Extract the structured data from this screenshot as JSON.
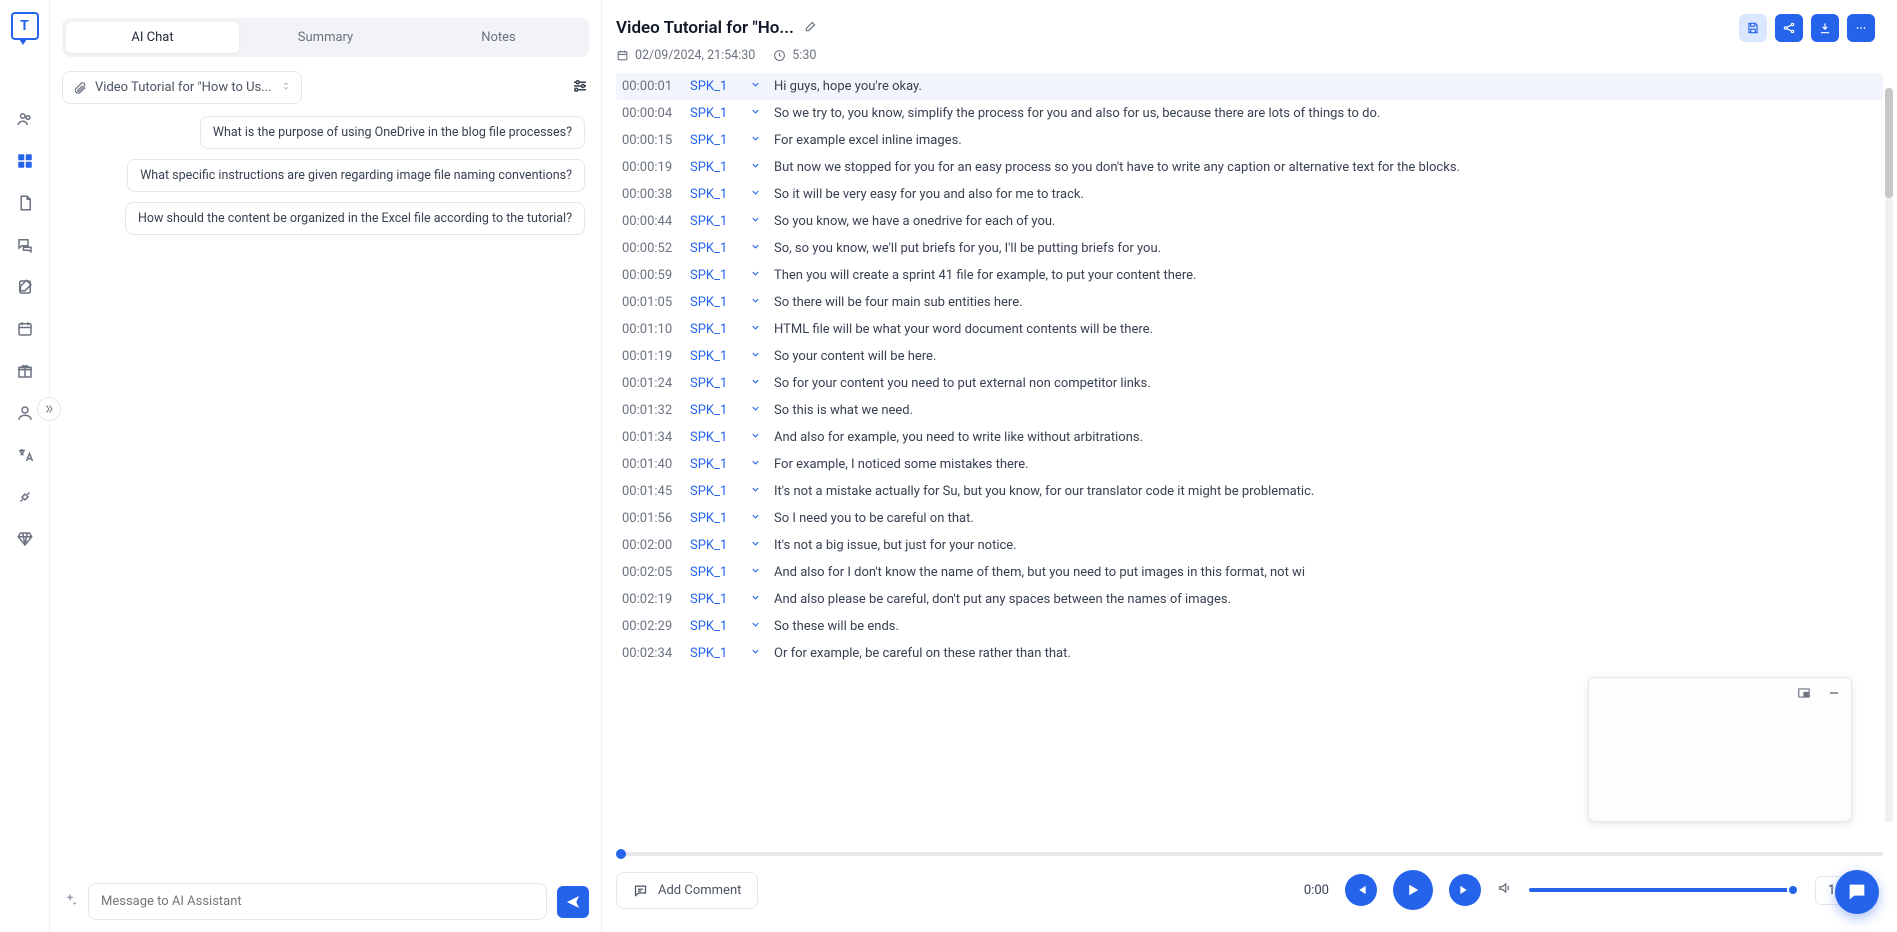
{
  "tabs": {
    "ai_chat": "AI Chat",
    "summary": "Summary",
    "notes": "Notes"
  },
  "file_chip": "Video Tutorial for \"How to Us...",
  "suggestions": [
    "What is the purpose of using OneDrive in the blog file processes?",
    "What specific instructions are given regarding image file naming conventions?",
    "How should the content be organized in the Excel file according to the tutorial?"
  ],
  "msg_placeholder": "Message to AI Assistant",
  "title": "Video Tutorial for \"Ho...",
  "meta": {
    "date": "02/09/2024, 21:54:30",
    "duration": "5:30"
  },
  "transcript": [
    {
      "t": "00:00:01",
      "s": "SPK_1",
      "x": "Hi guys, hope you're okay.",
      "hl": true
    },
    {
      "t": "00:00:04",
      "s": "SPK_1",
      "x": "So we try to, you know, simplify the process for you and also for us, because there are lots of things to do."
    },
    {
      "t": "00:00:15",
      "s": "SPK_1",
      "x": "For example excel inline images."
    },
    {
      "t": "00:00:19",
      "s": "SPK_1",
      "x": "But now we stopped for you for an easy process so you don't have to write any caption or alternative text for the blocks."
    },
    {
      "t": "00:00:38",
      "s": "SPK_1",
      "x": "So it will be very easy for you and also for me to track."
    },
    {
      "t": "00:00:44",
      "s": "SPK_1",
      "x": "So you know, we have a onedrive for each of you."
    },
    {
      "t": "00:00:52",
      "s": "SPK_1",
      "x": "So, so you know, we'll put briefs for you, I'll be putting briefs for you."
    },
    {
      "t": "00:00:59",
      "s": "SPK_1",
      "x": "Then you will create a sprint 41 file for example, to put your content there."
    },
    {
      "t": "00:01:05",
      "s": "SPK_1",
      "x": "So there will be four main sub entities here."
    },
    {
      "t": "00:01:10",
      "s": "SPK_1",
      "x": "HTML file will be what your word document contents will be there."
    },
    {
      "t": "00:01:19",
      "s": "SPK_1",
      "x": "So your content will be here."
    },
    {
      "t": "00:01:24",
      "s": "SPK_1",
      "x": "So for your content you need to put external non competitor links."
    },
    {
      "t": "00:01:32",
      "s": "SPK_1",
      "x": "So this is what we need."
    },
    {
      "t": "00:01:34",
      "s": "SPK_1",
      "x": "And also for example, you need to write like without arbitrations."
    },
    {
      "t": "00:01:40",
      "s": "SPK_1",
      "x": "For example, I noticed some mistakes there."
    },
    {
      "t": "00:01:45",
      "s": "SPK_1",
      "x": "It's not a mistake actually for Su, but you know, for our translator code it might be problematic."
    },
    {
      "t": "00:01:56",
      "s": "SPK_1",
      "x": "So I need you to be careful on that."
    },
    {
      "t": "00:02:00",
      "s": "SPK_1",
      "x": "It's not a big issue, but just for your notice."
    },
    {
      "t": "00:02:05",
      "s": "SPK_1",
      "x": "And also for I don't know the name of them, but you need to put images in this format, not wi"
    },
    {
      "t": "00:02:19",
      "s": "SPK_1",
      "x": "And also please be careful, don't put any spaces between the names of images."
    },
    {
      "t": "00:02:29",
      "s": "SPK_1",
      "x": "So these will be ends."
    },
    {
      "t": "00:02:34",
      "s": "SPK_1",
      "x": "Or for example, be careful on these rather than that."
    }
  ],
  "player": {
    "add_comment": "Add Comment",
    "current": "0:00",
    "speed": "1x"
  }
}
